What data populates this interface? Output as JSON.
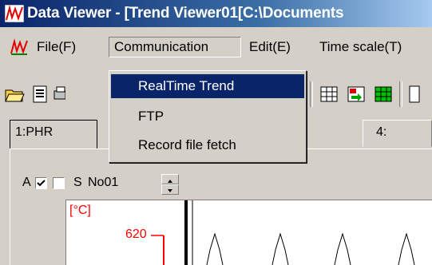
{
  "window": {
    "title": "Data Viewer - [Trend Viewer01[C:\\Documents"
  },
  "menubar": {
    "items": [
      "File(F)",
      "Communication",
      "Edit(E)",
      "Time scale(T)"
    ]
  },
  "communication_menu": {
    "items": [
      "RealTime Trend",
      "FTP",
      "Record file fetch"
    ],
    "highlighted": "RealTime Trend"
  },
  "tabs": [
    {
      "label": "1:PHR",
      "active": true
    },
    {
      "label": "4:",
      "active": false
    }
  ],
  "controls": {
    "a_label": "A",
    "a_checked": true,
    "s_label": "S",
    "channel": "No01"
  },
  "plot": {
    "unit_label": "[°C]",
    "tick_value": "620"
  },
  "colors": {
    "title_gradient_start": "#0a246a",
    "menu_highlight": "#0a246a",
    "plot_red": "#ff0000"
  }
}
